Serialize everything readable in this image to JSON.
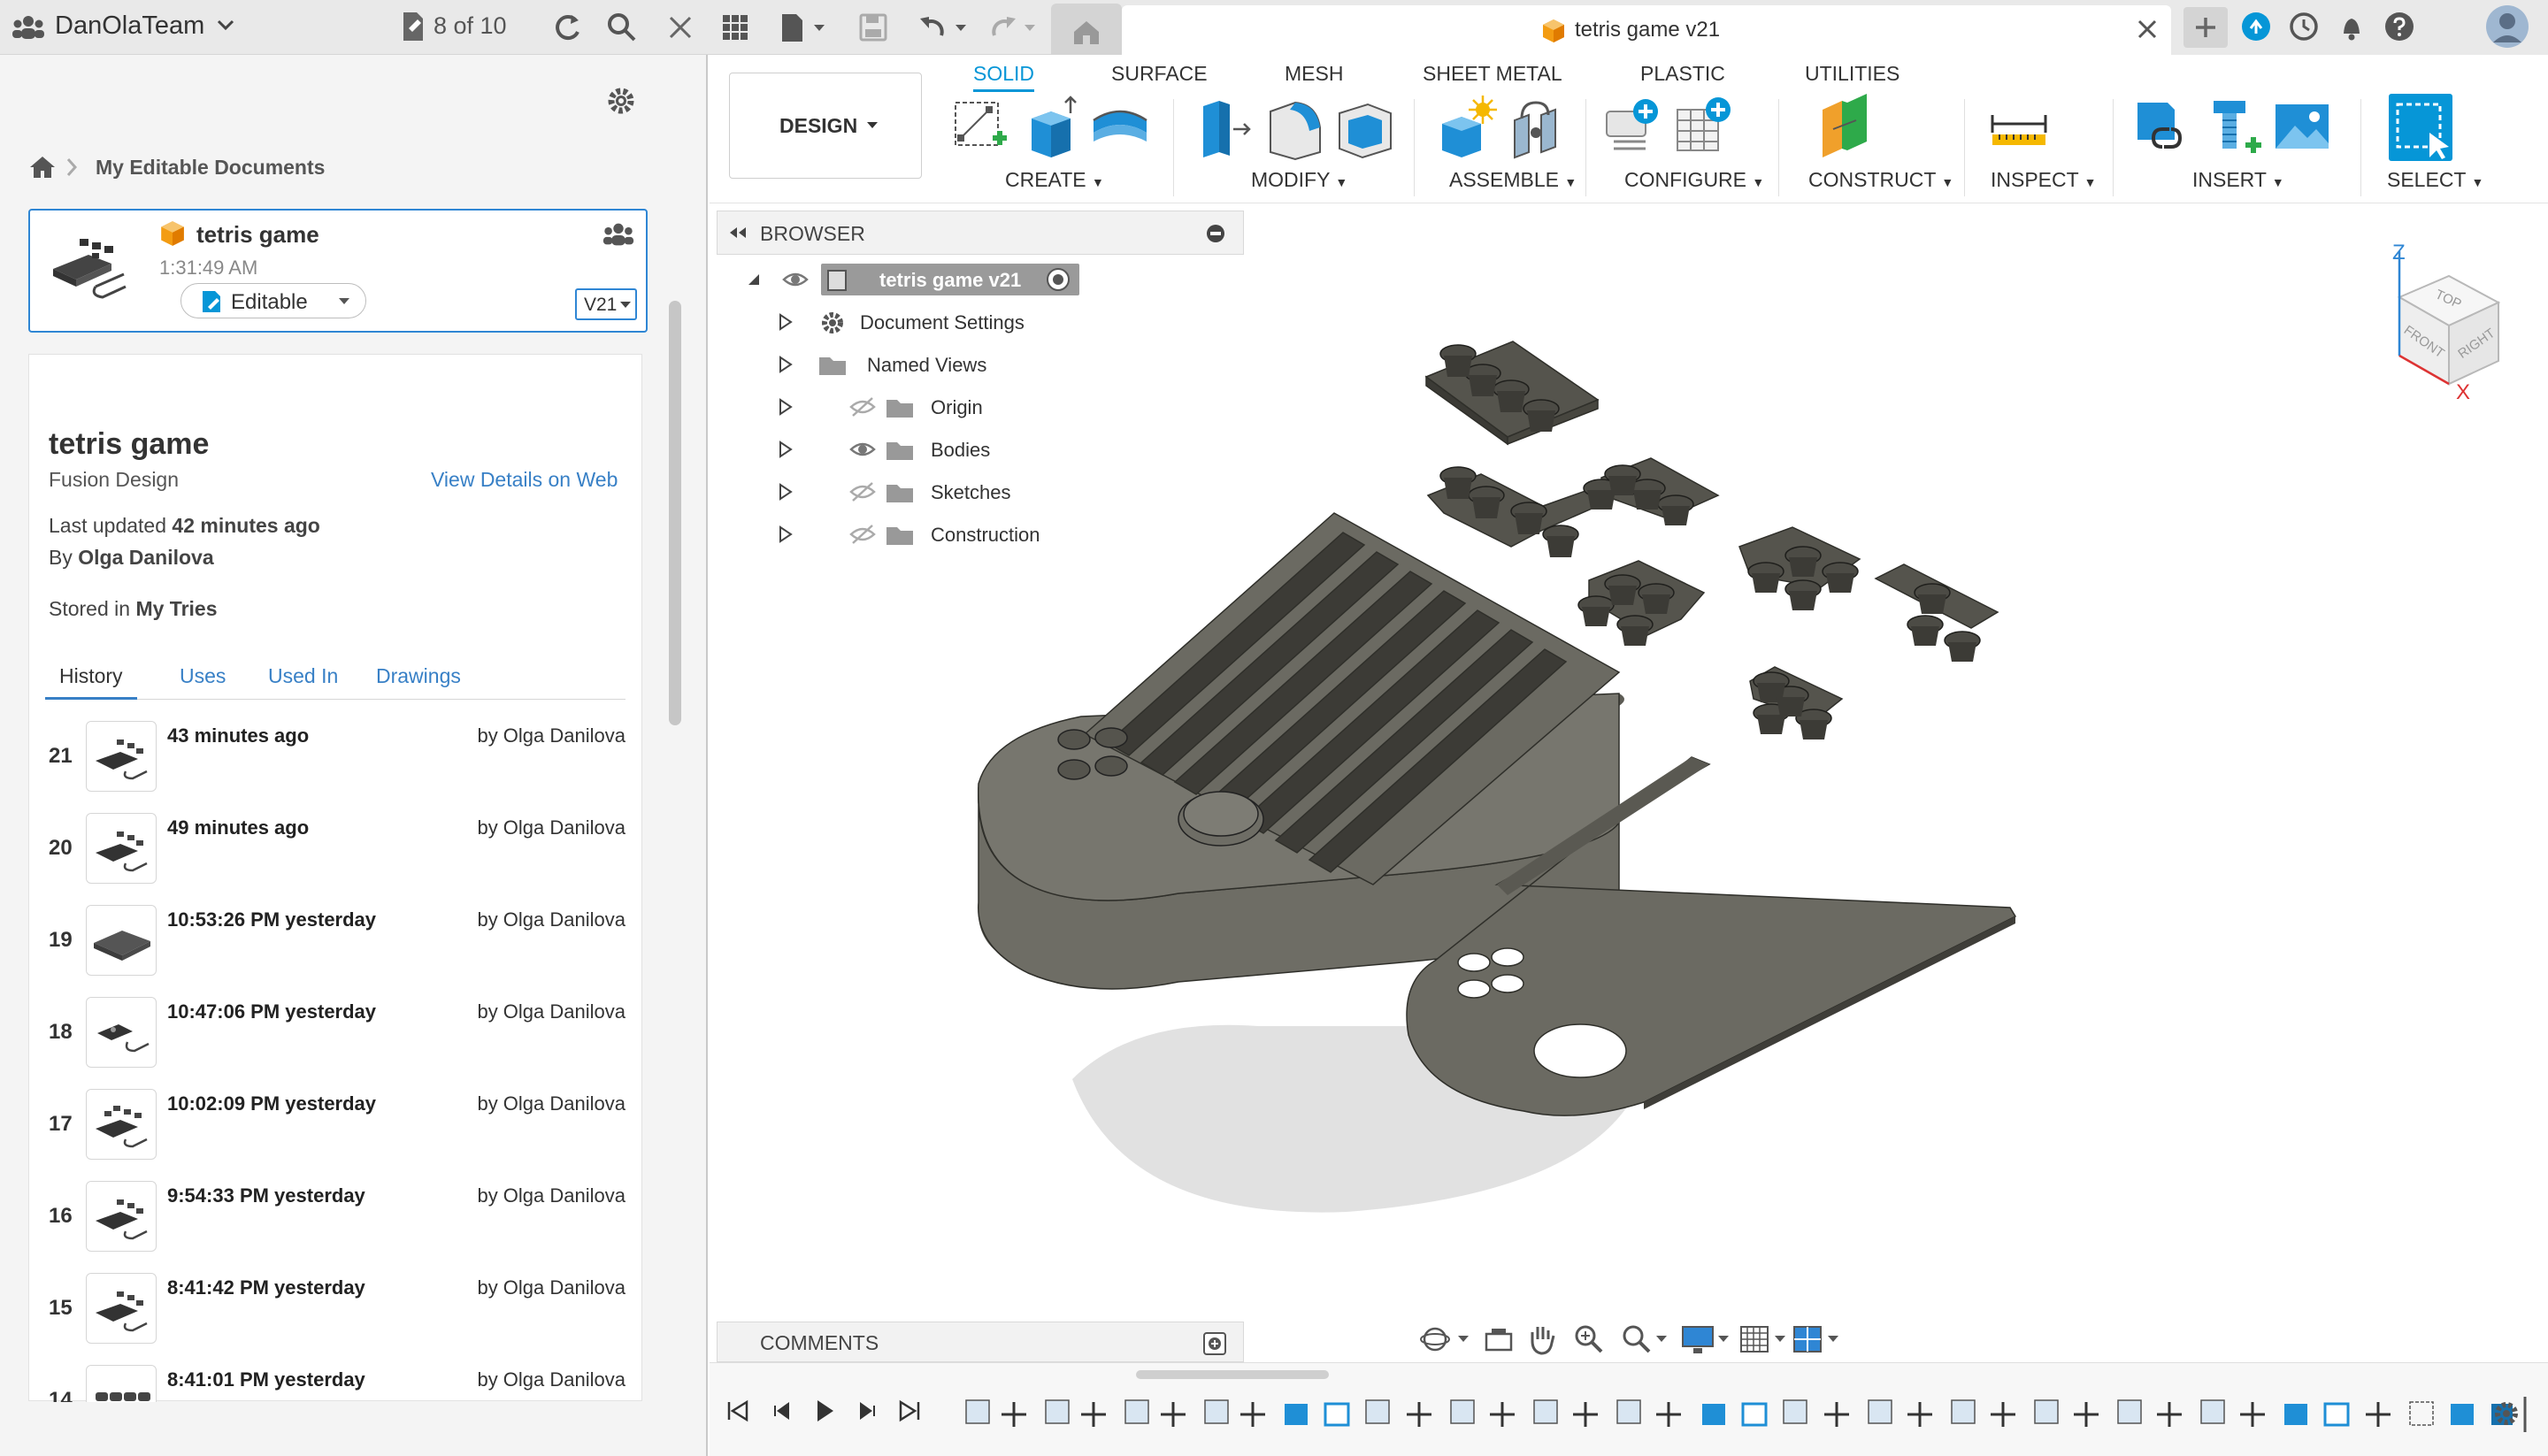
{
  "team": {
    "name": "DanOlaTeam"
  },
  "topbar": {
    "doc_counter": "8 of 10"
  },
  "doc_tab": {
    "title": "tetris game v21"
  },
  "breadcrumb": {
    "label": "My Editable Documents"
  },
  "card": {
    "title": "tetris game",
    "time": "1:31:49 AM",
    "status": "Editable",
    "version": "V21"
  },
  "details": {
    "title": "tetris game",
    "subtitle": "Fusion Design",
    "view_link": "View Details on Web",
    "updated_prefix": "Last updated",
    "updated_value": "42 minutes ago",
    "by_prefix": "By",
    "by_value": "Olga Danilova",
    "stored_prefix": "Stored in",
    "stored_value": "My Tries"
  },
  "detail_tabs": [
    "History",
    "Uses",
    "Used In",
    "Drawings"
  ],
  "history": [
    {
      "num": "21",
      "time": "43 minutes ago",
      "by": "by Olga Danilova"
    },
    {
      "num": "20",
      "time": "49 minutes ago",
      "by": "by Olga Danilova"
    },
    {
      "num": "19",
      "time": "10:53:26 PM yesterday",
      "by": "by Olga Danilova"
    },
    {
      "num": "18",
      "time": "10:47:06 PM yesterday",
      "by": "by Olga Danilova"
    },
    {
      "num": "17",
      "time": "10:02:09 PM yesterday",
      "by": "by Olga Danilova"
    },
    {
      "num": "16",
      "time": "9:54:33 PM yesterday",
      "by": "by Olga Danilova"
    },
    {
      "num": "15",
      "time": "8:41:42 PM yesterday",
      "by": "by Olga Danilova"
    },
    {
      "num": "14",
      "time": "8:41:01 PM yesterday",
      "by": "by Olga Danilova"
    }
  ],
  "workspace": {
    "label": "DESIGN"
  },
  "ribbon_tabs": [
    "SOLID",
    "SURFACE",
    "MESH",
    "SHEET METAL",
    "PLASTIC",
    "UTILITIES"
  ],
  "ribbon_groups": [
    "CREATE",
    "MODIFY",
    "ASSEMBLE",
    "CONFIGURE",
    "CONSTRUCT",
    "INSPECT",
    "INSERT",
    "SELECT"
  ],
  "browser": {
    "title": "BROWSER",
    "root": "tetris game v21",
    "nodes": [
      "Document Settings",
      "Named Views",
      "Origin",
      "Bodies",
      "Sketches",
      "Construction"
    ]
  },
  "viewcube": {
    "top": "TOP",
    "front": "FRONT",
    "right": "RIGHT",
    "axis_z": "Z",
    "axis_x": "X"
  },
  "comments": {
    "label": "COMMENTS"
  },
  "colors": {
    "accent": "#0696d7",
    "selection_border": "#2f86d4",
    "model": "#6b6b62"
  }
}
